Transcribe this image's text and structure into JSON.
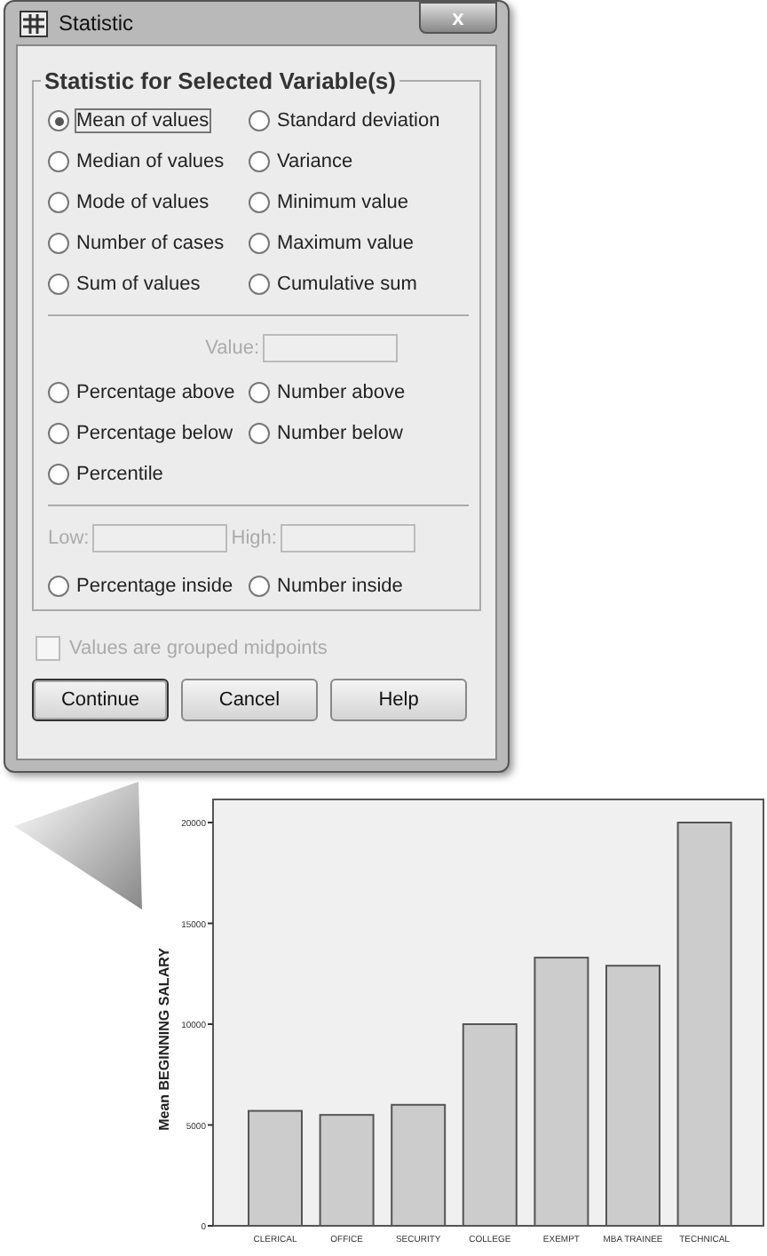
{
  "dialog": {
    "title": "Statistic",
    "close_label": "x",
    "group_title": "Statistic for Selected Variable(s)",
    "statistics": [
      {
        "label": "Mean of values",
        "selected": true
      },
      {
        "label": "Standard deviation",
        "selected": false
      },
      {
        "label": "Median of values",
        "selected": false
      },
      {
        "label": "Variance",
        "selected": false
      },
      {
        "label": "Mode of values",
        "selected": false
      },
      {
        "label": "Minimum value",
        "selected": false
      },
      {
        "label": "Number of cases",
        "selected": false
      },
      {
        "label": "Maximum value",
        "selected": false
      },
      {
        "label": "Sum of values",
        "selected": false
      },
      {
        "label": "Cumulative sum",
        "selected": false
      }
    ],
    "value_field": {
      "label": "Value:",
      "disabled": true
    },
    "thresholds": [
      {
        "label": "Percentage above",
        "selected": false
      },
      {
        "label": "Number above",
        "selected": false
      },
      {
        "label": "Percentage below",
        "selected": false
      },
      {
        "label": "Number below",
        "selected": false
      },
      {
        "label": "Percentile",
        "selected": false
      }
    ],
    "low_field": {
      "label": "Low:",
      "disabled": true
    },
    "high_field": {
      "label": "High:",
      "disabled": true
    },
    "ranges": [
      {
        "label": "Percentage inside",
        "selected": false
      },
      {
        "label": "Number inside",
        "selected": false
      }
    ],
    "grouped_checkbox": {
      "label": "Values are grouped midpoints",
      "checked": false,
      "disabled": true
    },
    "buttons": [
      {
        "label": "Continue",
        "default": true
      },
      {
        "label": "Cancel",
        "default": false
      },
      {
        "label": "Help",
        "default": false
      }
    ]
  },
  "chart": {
    "chart_data": {
      "type": "bar",
      "ylabel": "Mean BEGINNING SALARY",
      "categories": [
        "CLERICAL",
        "OFFICE",
        "SECURITY",
        "COLLEGE",
        "EXEMPT",
        "MBA TRAINEE",
        "TECHNICAL"
      ],
      "values": [
        5700,
        5500,
        6000,
        10000,
        13300,
        12900,
        20000
      ],
      "ylim": [
        0,
        20000
      ],
      "yticks": [
        0,
        5000,
        10000,
        15000,
        20000
      ]
    }
  }
}
